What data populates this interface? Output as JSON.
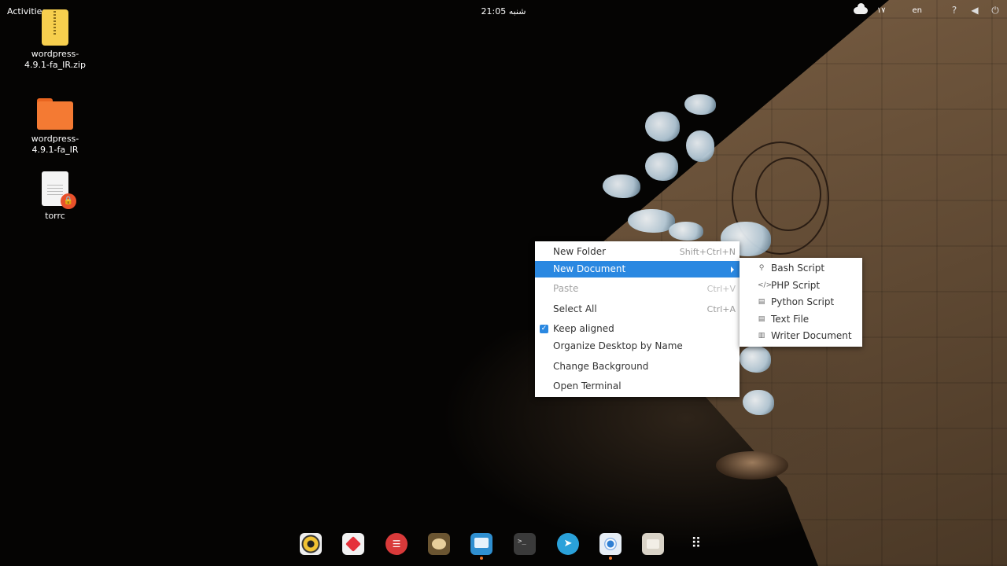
{
  "topbar": {
    "activities": "Activities",
    "clock": "شنبه 21:05",
    "tray_number": "۱۷",
    "language": "en"
  },
  "desktop": {
    "icons": [
      {
        "label_line1": "wordpress-",
        "label_line2": "4.9.1-fa_IR.zip",
        "icon": "zip-archive-icon"
      },
      {
        "label_line1": "wordpress-",
        "label_line2": "4.9.1-fa_IR",
        "icon": "folder-icon"
      },
      {
        "label_line1": "torrc",
        "label_line2": "",
        "icon": "text-file-locked-icon"
      }
    ]
  },
  "context_menu": {
    "items": [
      {
        "label": "New Folder",
        "accel": "Shift+Ctrl+N"
      },
      {
        "label": "New Document",
        "accel": ""
      },
      {
        "label": "Paste",
        "accel": "Ctrl+V"
      },
      {
        "label": "Select All",
        "accel": "Ctrl+A"
      },
      {
        "label": "Keep aligned",
        "accel": ""
      },
      {
        "label": "Organize Desktop by Name",
        "accel": ""
      },
      {
        "label": "Change Background",
        "accel": ""
      },
      {
        "label": "Open Terminal",
        "accel": ""
      }
    ]
  },
  "submenu": {
    "items": [
      {
        "label": "Bash Script",
        "icon": "bash-script-icon"
      },
      {
        "label": "PHP Script",
        "icon": "code-icon"
      },
      {
        "label": "Python Script",
        "icon": "document-icon"
      },
      {
        "label": "Text File",
        "icon": "text-file-icon"
      },
      {
        "label": "Writer Document",
        "icon": "writer-document-icon"
      }
    ]
  },
  "dock": {
    "apps": [
      "rhythmbox-icon",
      "app-red-diamond-icon",
      "app-red-round-icon",
      "gimp-icon",
      "screenshot-app-icon",
      "terminal-icon",
      "telegram-icon",
      "chromium-icon",
      "files-icon",
      "show-apps-grid-icon"
    ]
  },
  "colors": {
    "menu_highlight": "#2a88e1",
    "folder": "#f47a33",
    "zip": "#f7cf4e"
  }
}
